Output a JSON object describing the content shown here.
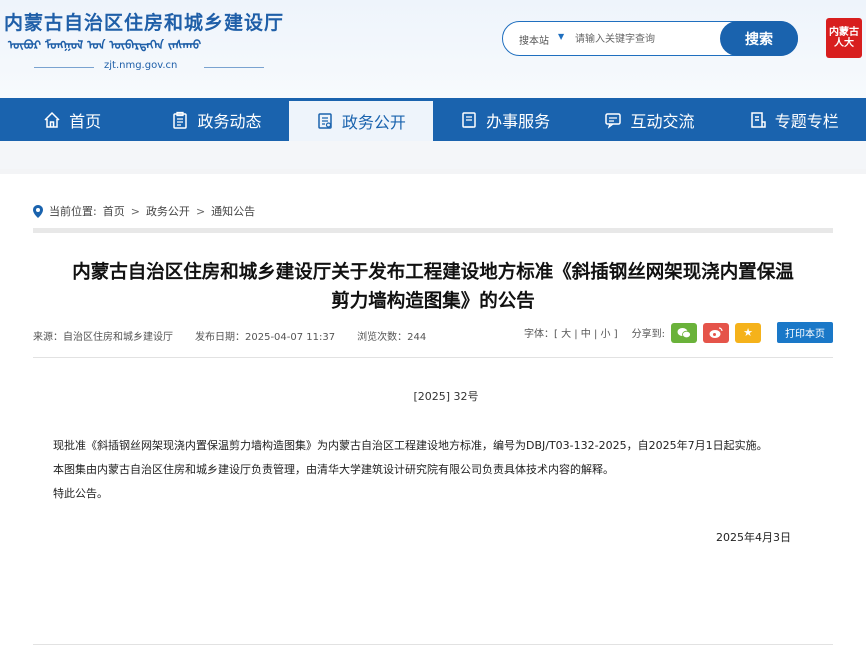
{
  "header": {
    "site_title": "内蒙古自治区住房和城乡建设厅",
    "mongolian_script": "ᠥᠪᠥᠷ ᠮᠣᠩᠭᠣᠯ ᠤᠨ ᠥᠪᠡᠷᠲᠡᠭᠡᠨ ᠵᠠᠰᠠᠬᠤ",
    "domain": "zjt.nmg.gov.cn",
    "search": {
      "scope": "搜本站",
      "placeholder": "请输入关键字查询",
      "button": "搜索"
    },
    "seal_text": "内蒙古 人大"
  },
  "nav": {
    "items": [
      {
        "label": "首页",
        "icon": "home-icon"
      },
      {
        "label": "政务动态",
        "icon": "clipboard-icon"
      },
      {
        "label": "政务公开",
        "icon": "list-doc-icon",
        "active": true
      },
      {
        "label": "办事服务",
        "icon": "document-icon"
      },
      {
        "label": "互动交流",
        "icon": "chat-icon"
      },
      {
        "label": "专题专栏",
        "icon": "column-icon"
      }
    ]
  },
  "breadcrumb": {
    "prefix": "当前位置:",
    "items": [
      "首页",
      "政务公开",
      "通知公告"
    ],
    "sep": ">"
  },
  "article": {
    "title_line1": "内蒙古自治区住房和城乡建设厅关于发布工程建设地方标准《斜插钢丝网架现浇内置保温",
    "title_line2": "剪力墙构造图集》的公告",
    "meta": {
      "source": "来源：自治区住房和城乡建设厅",
      "date": "发布日期：2025-04-07 11:37",
      "views": "浏览次数：244"
    },
    "tools": {
      "font_label": "字体：[ 大 | 中 | 小 ]",
      "share_label": "分享到:",
      "print": "打印本页"
    },
    "doc_number": "[2025] 32号",
    "paragraphs": [
      "现批准《斜插钢丝网架现浇内置保温剪力墙构造图集》为内蒙古自治区工程建设地方标准，编号为DBJ/T03-132-2025，自2025年7月1日起实施。",
      "本图集由内蒙古自治区住房和城乡建设厅负责管理，由清华大学建筑设计研究院有限公司负责具体技术内容的解释。",
      "特此公告。"
    ],
    "sign_date": "2025年4月3日"
  },
  "colors": {
    "primary": "#1a63ae",
    "wechat": "#6ab23a",
    "weibo": "#e5544a",
    "favorite": "#f5b21b"
  }
}
